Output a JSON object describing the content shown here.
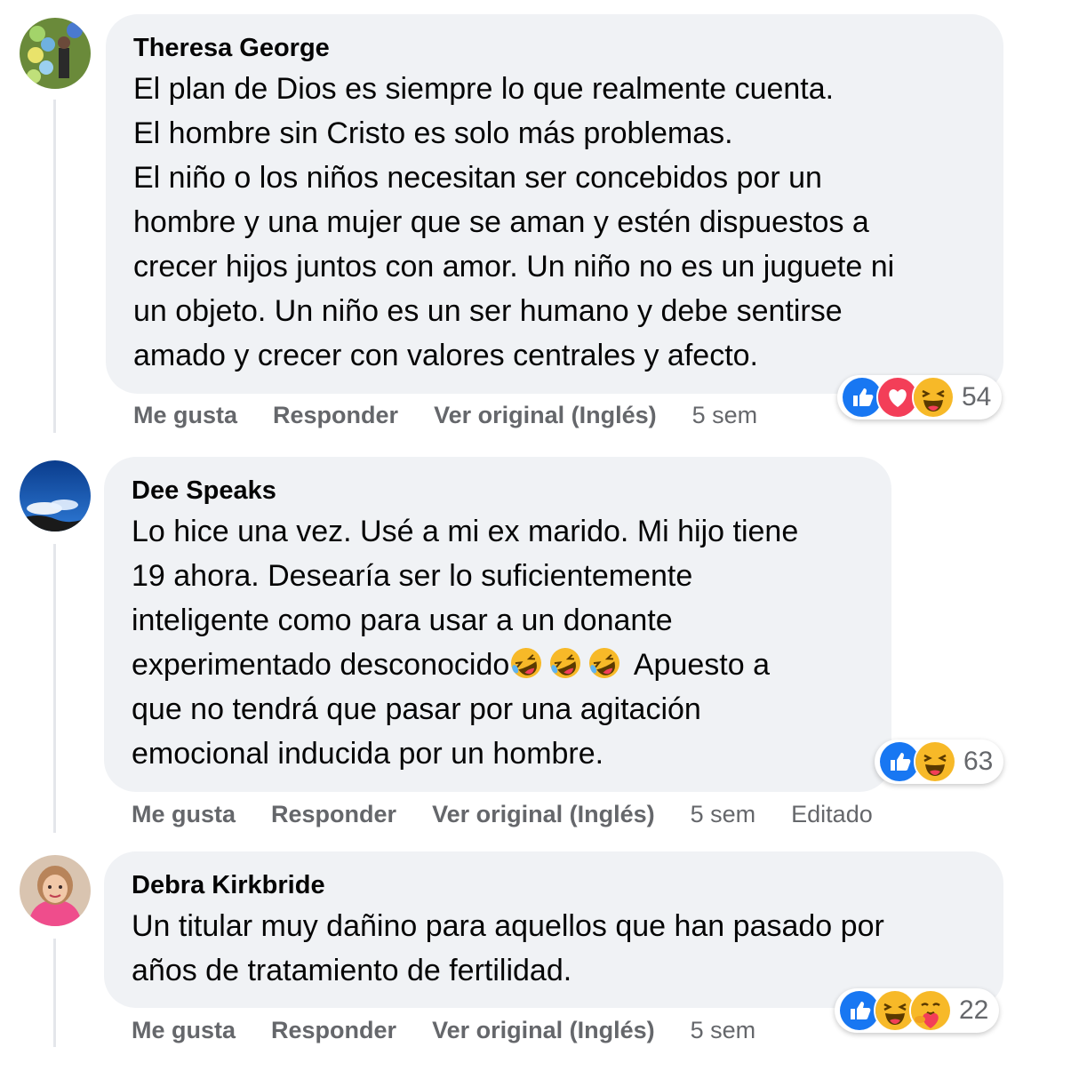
{
  "comments": [
    {
      "author": "Theresa George",
      "lines": [
        "El plan de Dios es siempre lo que realmente cuenta.",
        "El hombre sin Cristo es solo más problemas.",
        "El niño o los niños necesitan ser concebidos por un",
        "hombre y una mujer que se aman y estén dispuestos a",
        "crecer hijos juntos con amor. Un niño no es un juguete ni",
        "un objeto. Un niño es un ser humano y debe sentirse",
        "amado y crecer con valores centrales y afecto."
      ],
      "like_label": "Me gusta",
      "reply_label": "Responder",
      "translate_label": "Ver original (Inglés)",
      "time": "5 sem",
      "reaction_types": [
        "like-icon",
        "love-icon",
        "haha-icon"
      ],
      "reaction_count": "54"
    },
    {
      "author": "Dee Speaks",
      "lines": [
        "Lo hice una vez. Usé a mi ex marido. Mi hijo tiene",
        "19 ahora. Desearía ser lo suficientemente",
        "inteligente como para usar a un donante",
        "experimentado desconocido",
        "que no tendrá que pasar por una agitación",
        "emocional inducida por un hombre."
      ],
      "line4_suffix": "Apuesto a",
      "inline_emojis": [
        "rolling-on-floor-laughing-emoji",
        "rolling-on-floor-laughing-emoji",
        "rolling-on-floor-laughing-emoji"
      ],
      "like_label": "Me gusta",
      "reply_label": "Responder",
      "translate_label": "Ver original (Inglés)",
      "time": "5 sem",
      "edited_label": "Editado",
      "reaction_types": [
        "like-icon",
        "haha-icon"
      ],
      "reaction_count": "63"
    },
    {
      "author": "Debra Kirkbride",
      "lines": [
        "Un titular muy dañino para aquellos que han pasado por",
        "años de tratamiento de fertilidad."
      ],
      "like_label": "Me gusta",
      "reply_label": "Responder",
      "translate_label": "Ver original (Inglés)",
      "time": "5 sem",
      "reaction_types": [
        "like-icon",
        "haha-icon",
        "care-icon"
      ],
      "reaction_count": "22"
    }
  ],
  "colors": {
    "bubble": "#f0f2f5",
    "muted_text": "#65676b",
    "like_blue": "#1877f2",
    "love_red": "#f33e58",
    "haha_yellow": "#f7b928"
  }
}
